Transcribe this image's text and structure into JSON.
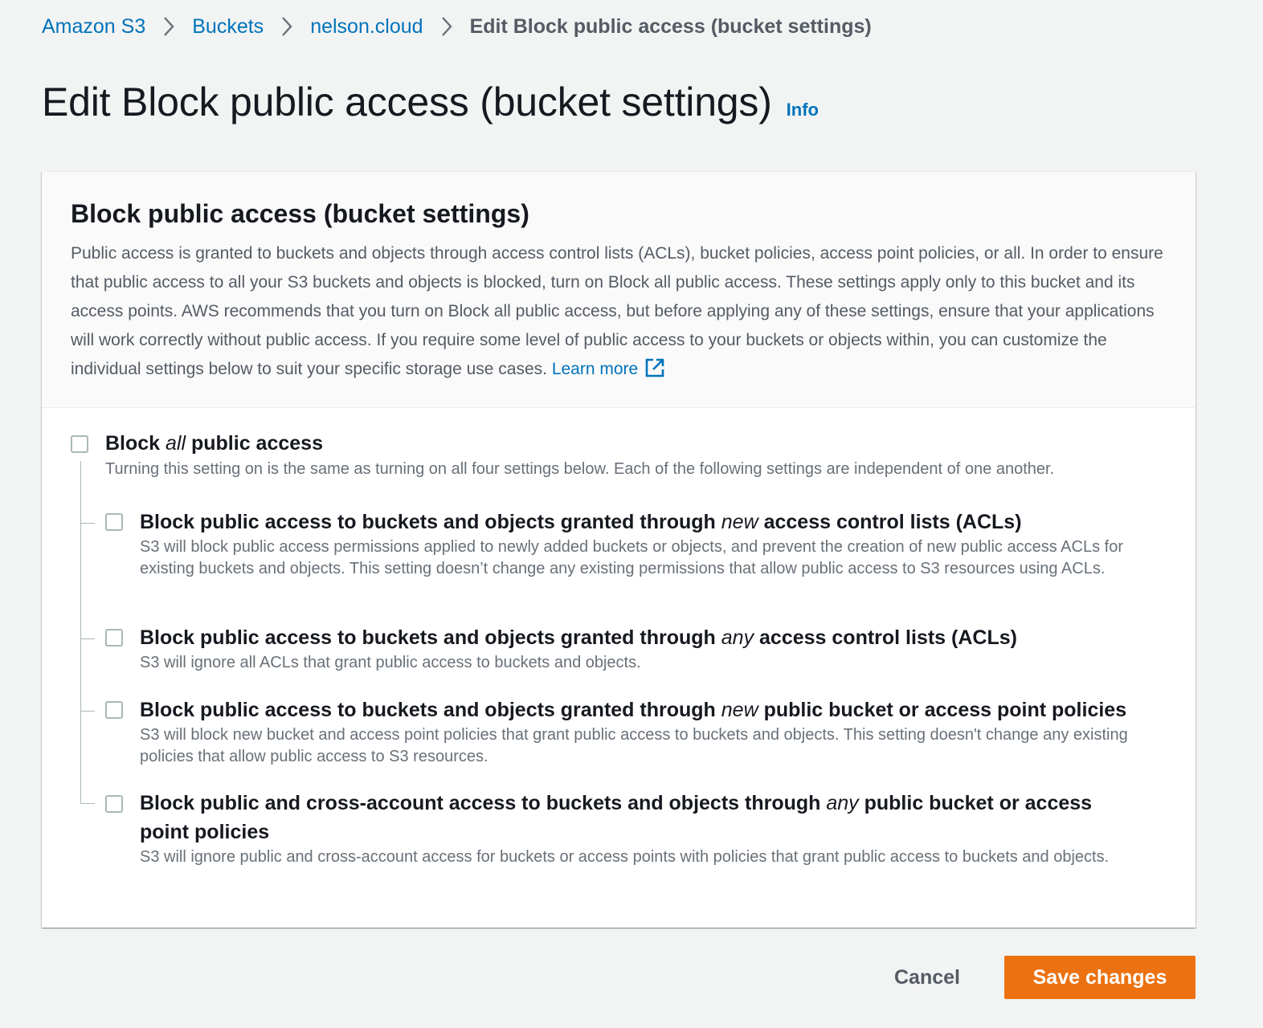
{
  "breadcrumb": {
    "items": [
      {
        "label": "Amazon S3"
      },
      {
        "label": "Buckets"
      },
      {
        "label": "nelson.cloud"
      }
    ],
    "current": "Edit Block public access (bucket settings)"
  },
  "page": {
    "title": "Edit Block public access (bucket settings)",
    "info_label": "Info"
  },
  "panel": {
    "title": "Block public access (bucket settings)",
    "description": "Public access is granted to buckets and objects through access control lists (ACLs), bucket policies, access point policies, or all. In order to ensure that public access to all your S3 buckets and objects is blocked, turn on Block all public access. These settings apply only to this bucket and its access points. AWS recommends that you turn on Block all public access, but before applying any of these settings, ensure that your applications will work correctly without public access. If you require some level of public access to your buckets or objects within, you can customize the individual settings below to suit your specific storage use cases.",
    "learn_more": "Learn more",
    "learn_more_icon": "external-link-icon"
  },
  "options": {
    "block_all": {
      "label_before": "Block ",
      "label_em": "all",
      "label_after": " public access",
      "description": "Turning this setting on is the same as turning on all four settings below. Each of the following settings are independent of one another.",
      "checked": false
    },
    "new_acls": {
      "label_before": "Block public access to buckets and objects granted through ",
      "label_em": "new",
      "label_after": " access control lists (ACLs)",
      "description": "S3 will block public access permissions applied to newly added buckets or objects, and prevent the creation of new public access ACLs for existing buckets and objects. This setting doesn’t change any existing permissions that allow public access to S3 resources using ACLs.",
      "checked": false
    },
    "any_acls": {
      "label_before": "Block public access to buckets and objects granted through ",
      "label_em": "any",
      "label_after": " access control lists (ACLs)",
      "description": "S3 will ignore all ACLs that grant public access to buckets and objects.",
      "checked": false
    },
    "new_policies": {
      "label_before": "Block public access to buckets and objects granted through ",
      "label_em": "new",
      "label_after": " public bucket or access point policies",
      "description": "S3 will block new bucket and access point policies that grant public access to buckets and objects. This setting doesn't change any existing policies that allow public access to S3 resources.",
      "checked": false
    },
    "any_policies": {
      "label_before": "Block public and cross-account access to buckets and objects through ",
      "label_em": "any",
      "label_after": " public bucket or access point policies",
      "description": "S3 will ignore public and cross-account access for buckets or access points with policies that grant public access to buckets and objects.",
      "checked": false
    }
  },
  "footer": {
    "cancel_label": "Cancel",
    "save_label": "Save changes"
  },
  "colors": {
    "link": "#0073bb",
    "primary_button": "#ec7211",
    "background": "#f2f3f3"
  }
}
